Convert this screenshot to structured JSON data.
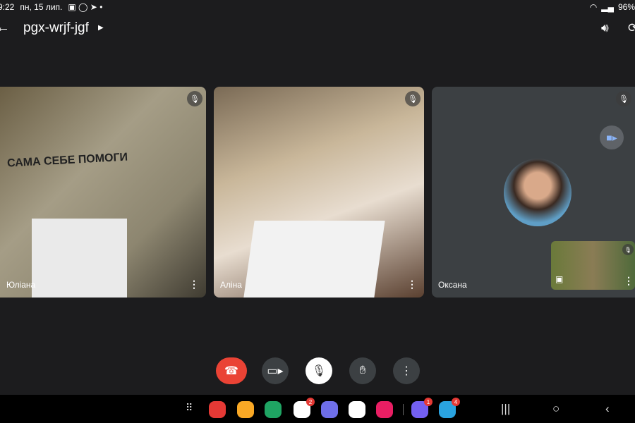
{
  "status": {
    "time": "9:22",
    "date": "пн, 15 лип.",
    "battery": "96%"
  },
  "header": {
    "meeting_code": "pgx-wrjf-jgf"
  },
  "tiles": [
    {
      "name": "Юліана",
      "wall_text": "САМА СЕБЕ ПОМОГИ",
      "muted": true
    },
    {
      "name": "Аліна",
      "muted": true
    },
    {
      "name": "Оксана",
      "muted": true
    }
  ],
  "dock": {
    "apps": [
      {
        "name": "notes",
        "color": "#e53935"
      },
      {
        "name": "files",
        "color": "#f9a825"
      },
      {
        "name": "phone",
        "color": "#1fa463"
      },
      {
        "name": "messages",
        "color": "#ffffff",
        "badge": "2"
      },
      {
        "name": "internet",
        "color": "#6e6ee8"
      },
      {
        "name": "teams",
        "color": "#ffffff"
      },
      {
        "name": "screen-recorder",
        "color": "#e91e63"
      },
      {
        "name": "viber",
        "color": "#7360f2",
        "badge": "1"
      },
      {
        "name": "telegram",
        "color": "#2aa3e0",
        "badge": "4"
      }
    ]
  },
  "colors": {
    "end_call": "#ea4335",
    "background": "#1c1c1e"
  }
}
